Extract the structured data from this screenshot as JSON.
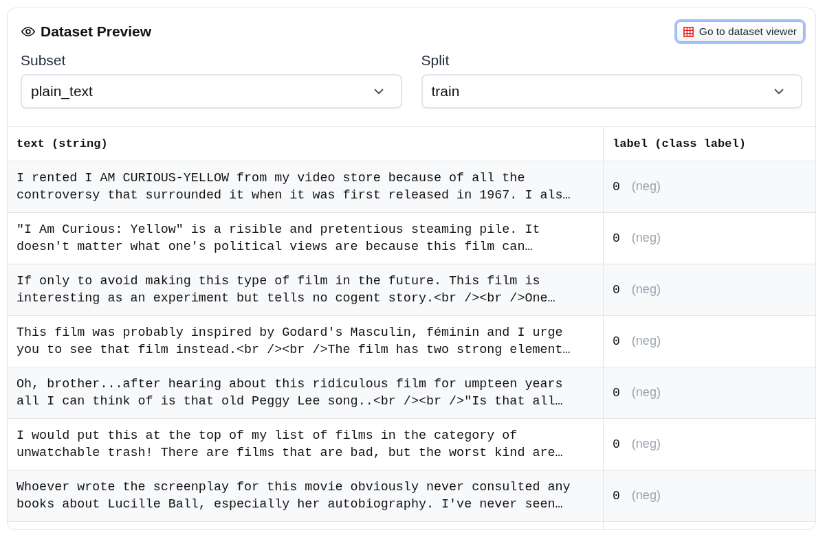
{
  "title": "Dataset Preview",
  "viewer_button": {
    "label": "Go to dataset viewer",
    "focused": true
  },
  "selects": [
    {
      "label": "Subset",
      "value": "plain_text"
    },
    {
      "label": "Split",
      "value": "train"
    }
  ],
  "table": {
    "columns": [
      "text (string)",
      "label (class label)"
    ],
    "rows": [
      {
        "text": "I rented I AM CURIOUS-YELLOW from my video store because of all the controversy that surrounded it when it was first released in 1967. I als…",
        "label": "0",
        "label_name": "(neg)"
      },
      {
        "text": "\"I Am Curious: Yellow\" is a risible and pretentious steaming pile. It doesn't matter what one's political views are because this film can…",
        "label": "0",
        "label_name": "(neg)"
      },
      {
        "text": "If only to avoid making this type of film in the future. This film is interesting as an experiment but tells no cogent story.<br /><br />One…",
        "label": "0",
        "label_name": "(neg)"
      },
      {
        "text": "This film was probably inspired by Godard's Masculin, féminin and I urge you to see that film instead.<br /><br />The film has two strong element…",
        "label": "0",
        "label_name": "(neg)"
      },
      {
        "text": "Oh, brother...after hearing about this ridiculous film for umpteen years all I can think of is that old Peggy Lee song..<br /><br />\"Is that all…",
        "label": "0",
        "label_name": "(neg)"
      },
      {
        "text": "I would put this at the top of my list of films in the category of unwatchable trash! There are films that are bad, but the worst kind are…",
        "label": "0",
        "label_name": "(neg)"
      },
      {
        "text": "Whoever wrote the screenplay for this movie obviously never consulted any books about Lucille Ball, especially her autobiography. I've never seen…",
        "label": "0",
        "label_name": "(neg)"
      }
    ]
  }
}
